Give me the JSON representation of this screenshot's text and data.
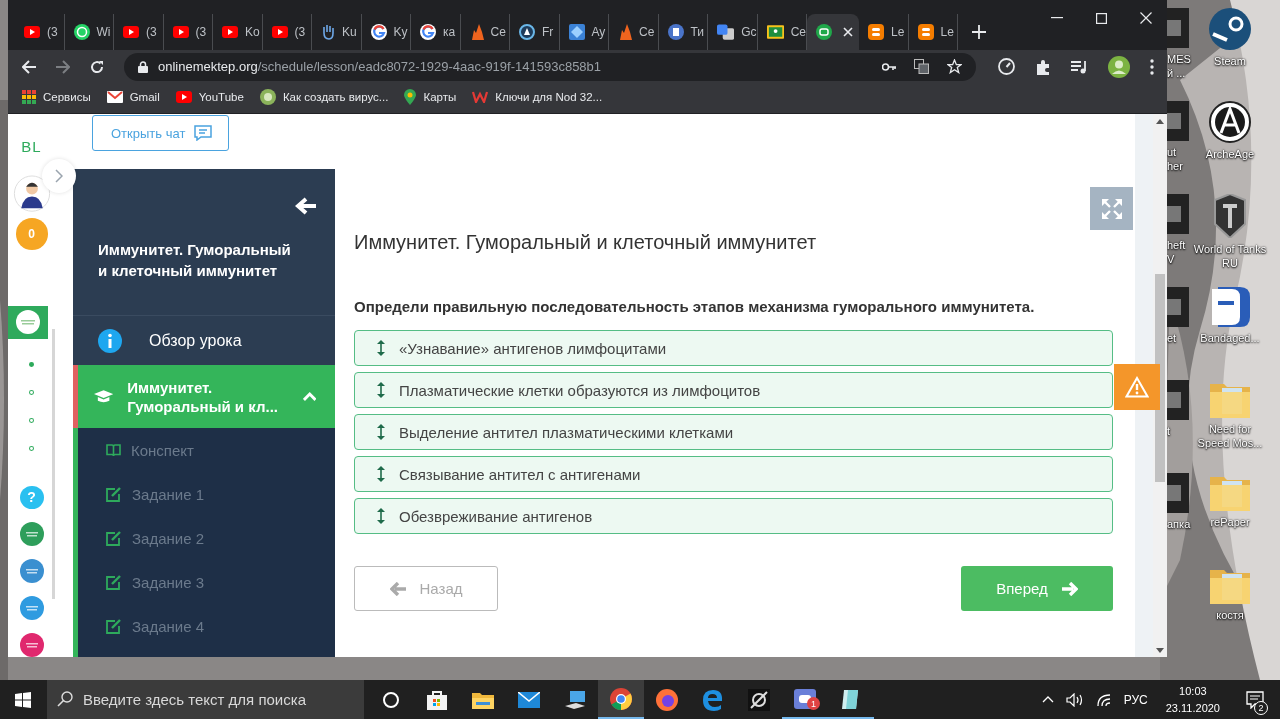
{
  "browser": {
    "tabs": [
      {
        "kind": "youtube",
        "title": "(3",
        "selected": false
      },
      {
        "kind": "whatsapp",
        "title": "Wi",
        "selected": false
      },
      {
        "kind": "youtube",
        "title": "(3",
        "selected": false
      },
      {
        "kind": "youtube",
        "title": "(3",
        "selected": false
      },
      {
        "kind": "youtube",
        "title": "Ko",
        "selected": false
      },
      {
        "kind": "youtube",
        "title": "(3",
        "selected": false
      },
      {
        "kind": "hand",
        "title": "Ku",
        "selected": false
      },
      {
        "kind": "google",
        "title": "Ky",
        "selected": false
      },
      {
        "kind": "google",
        "title": "ка",
        "selected": false
      },
      {
        "kind": "fox",
        "title": "Ce",
        "selected": false
      },
      {
        "kind": "compass",
        "title": "Fr",
        "selected": false
      },
      {
        "kind": "tile",
        "title": "Ay",
        "selected": false
      },
      {
        "kind": "fox",
        "title": "Ce",
        "selected": false
      },
      {
        "kind": "badge",
        "title": "Ти",
        "selected": false
      },
      {
        "kind": "translate",
        "title": "Gc",
        "selected": false
      },
      {
        "kind": "classroom",
        "title": "Ce",
        "selected": false
      },
      {
        "kind": "bilim",
        "selected": true
      },
      {
        "kind": "blogger",
        "title": "Le",
        "selected": false
      },
      {
        "kind": "blogger",
        "title": "Le",
        "selected": false
      }
    ],
    "address": {
      "host": "onlinemektep.org",
      "path": "/schedule/lesson/eadc8072-1929-4aac-919f-141593c858b1"
    },
    "bookmarks": [
      {
        "kind": "apps",
        "label": "Сервисы"
      },
      {
        "kind": "gmail",
        "label": "Gmail"
      },
      {
        "kind": "youtube",
        "label": "YouTube"
      },
      {
        "kind": "wiki",
        "label": "Как создать вирус..."
      },
      {
        "kind": "maps",
        "label": "Карты"
      },
      {
        "kind": "zigzag",
        "label": "Ключи для Nod 32..."
      }
    ]
  },
  "rail": {
    "logo": "BL",
    "coins": "0",
    "steps": [
      {
        "selected": true
      },
      {
        "selected": false
      },
      {
        "selected": false
      },
      {
        "selected": false
      }
    ],
    "help": "?",
    "apps": [
      {
        "color": "#2e9e5b"
      },
      {
        "color": "#3a8fd0"
      },
      {
        "color": "#2f9be0"
      },
      {
        "color": "#e0286e"
      }
    ]
  },
  "chat_button": "Открыть чат",
  "sidebar": {
    "title": "Иммунитет. Гуморальный и клеточный иммунитет",
    "items": [
      {
        "kind": "overview",
        "label": "Обзор урока",
        "selected": false
      },
      {
        "kind": "lesson",
        "label": "Иммунитет. Гуморальный и кл...",
        "selected": true,
        "expanded": true,
        "children": [
          {
            "kind": "notes",
            "label": "Конспект"
          },
          {
            "kind": "task",
            "label": "Задание 1"
          },
          {
            "kind": "task",
            "label": "Задание 2"
          },
          {
            "kind": "task",
            "label": "Задание 3"
          },
          {
            "kind": "task",
            "label": "Задание 4"
          }
        ]
      }
    ]
  },
  "lesson": {
    "title": "Иммунитет. Гуморальный и клеточный иммунитет",
    "question": "Определи правильную последовательность этапов механизма гуморального иммунитета.",
    "items": [
      "«Узнавание» антигенов лимфоцитами",
      "Плазматические клетки образуются из лимфоцитов",
      "Выделение антител плазматическими клетками",
      "Связывание антител с антигенами",
      "Обезвреживание антигенов"
    ],
    "back": {
      "label": "Назад",
      "disabled": true
    },
    "next": {
      "label": "Вперед",
      "disabled": false
    }
  },
  "desktop": {
    "rows": [
      {
        "cut": [
          "MES",
          "й ..."
        ],
        "kind": "steam",
        "label": "Steam"
      },
      {
        "cut": [
          "ut",
          "her"
        ],
        "kind": "archeage",
        "label": "ArcheAge"
      },
      {
        "cut": [
          "heft",
          "V"
        ],
        "kind": "tank",
        "label": "World of Tanks RU"
      },
      {
        "cut": [
          "et"
        ],
        "kind": "block",
        "label": "Bandaged..."
      },
      {
        "cut": [
          "t"
        ],
        "kind": "folder",
        "label": "Need for Speed Mos..."
      },
      {
        "cut": [
          "апка"
        ],
        "kind": "folder",
        "label": "rePaper"
      },
      {
        "cut": [],
        "kind": "folder",
        "label": "костя"
      }
    ]
  },
  "taskbar": {
    "search_placeholder": "Введите здесь текст для поиска",
    "apps": [
      {
        "kind": "cortana",
        "running": false,
        "selected": false
      },
      {
        "kind": "store",
        "running": false,
        "selected": false
      },
      {
        "kind": "explorer",
        "running": false,
        "selected": false
      },
      {
        "kind": "mail",
        "running": false,
        "selected": false
      },
      {
        "kind": "computer",
        "running": false,
        "selected": false
      },
      {
        "kind": "chrome",
        "running": true,
        "selected": true
      },
      {
        "kind": "firefox",
        "running": false,
        "selected": false
      },
      {
        "kind": "edge",
        "running": false,
        "selected": false
      },
      {
        "kind": "crossed",
        "running": false,
        "selected": false
      },
      {
        "kind": "gamepad",
        "running": true,
        "selected": false,
        "badge": "1"
      },
      {
        "kind": "notepad",
        "running": true,
        "selected": false
      }
    ],
    "tray": {
      "language": "РУС",
      "time": "10:03",
      "date": "23.11.2020",
      "notifications": "2"
    }
  }
}
